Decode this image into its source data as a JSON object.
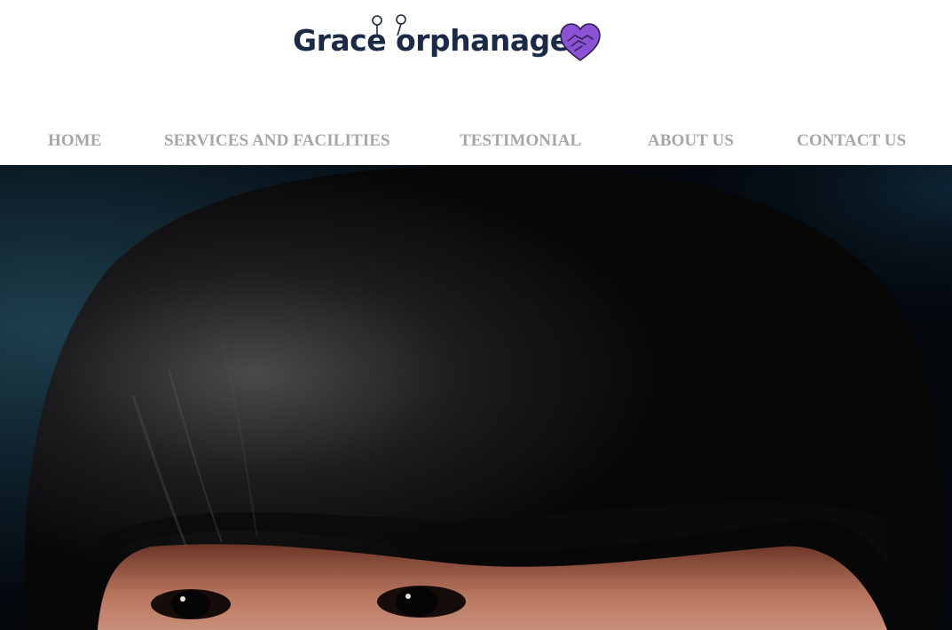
{
  "brand": {
    "name": "Grace orphanage",
    "logo_text_color": "#1b2a47",
    "heart_color": "#8b52d6",
    "heart_icon": "heart-hands-icon"
  },
  "nav": {
    "items": [
      {
        "label": "HOME"
      },
      {
        "label": "SERVICES AND FACILITIES"
      },
      {
        "label": "TESTIMONIAL"
      },
      {
        "label": "ABOUT US"
      },
      {
        "label": "CONTACT US"
      }
    ],
    "color": "#a6a6a6"
  },
  "hero": {
    "image": "child-portrait-photo",
    "background_color": "#04070c"
  }
}
